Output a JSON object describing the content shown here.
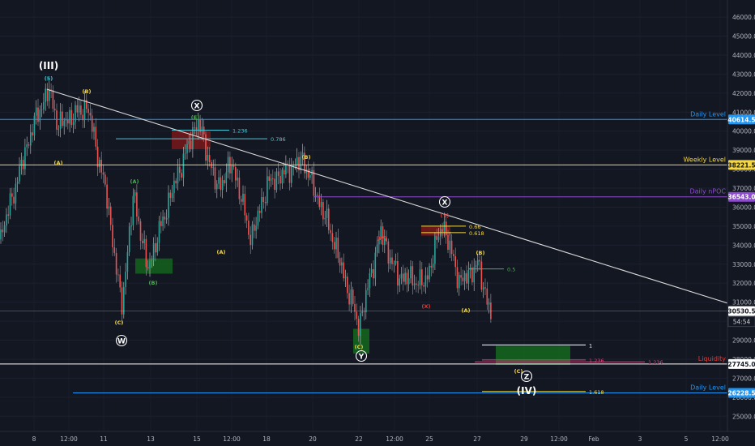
{
  "chart_data": {
    "type": "candlestick",
    "ylim": [
      24200,
      46900
    ],
    "y_ticks": [
      25000,
      26000,
      27000,
      28000,
      29000,
      30000,
      31000,
      32000,
      33000,
      34000,
      35000,
      36000,
      37000,
      38000,
      39000,
      40000,
      41000,
      42000,
      43000,
      44000,
      45000,
      46000
    ],
    "y_tick_labels": [
      "25000.0",
      "26000.0",
      "27000.0",
      "28000.0",
      "29000.0",
      "30000.0",
      "31000.0",
      "32000.0",
      "33000.0",
      "34000.0",
      "35000.0",
      "36000.0",
      "37000.0",
      "38000.0",
      "39000.0",
      "40000.0",
      "41000.0",
      "42000.0",
      "43000.0",
      "44000.0",
      "45000.0",
      "46000.0"
    ],
    "x_ticks": [
      "8",
      "12:00",
      "11",
      "13",
      "15",
      "12:00",
      "18",
      "20",
      "22",
      "12:00",
      "25",
      "27",
      "29",
      "12:00",
      "Feb",
      "3",
      "5",
      "12:00"
    ],
    "price_markers": [
      {
        "label": "Daily Level",
        "price": 40614.5,
        "price_text": "40614.5",
        "color": "#2196f3"
      },
      {
        "label": "Weekly Level",
        "price": 38221.5,
        "price_text": "38221.5",
        "color": "#f5d742"
      },
      {
        "label": "Daily nPOC",
        "price": 36543.0,
        "price_text": "36543.0",
        "color": "#8e4bd0"
      },
      {
        "label": "",
        "price": 30530.5,
        "price_text": "30530.5",
        "color": "#ffffff"
      },
      {
        "label": "Liquidity",
        "price": 27745.0,
        "price_text": "27745.0",
        "color": "#ffffff"
      },
      {
        "label": "Daily Level",
        "price": 26228.5,
        "price_text": "26228.5",
        "color": "#2196f3"
      }
    ],
    "countdown": "54:54",
    "fib_levels": [
      {
        "text": "1.236",
        "color": "#4ac7d6"
      },
      {
        "text": "0.786",
        "color": "#4ac7d6"
      },
      {
        "text": "0.66",
        "color": "#f5d742"
      },
      {
        "text": "0.618",
        "color": "#f5d742"
      },
      {
        "text": "0.5",
        "color": "#4caf50"
      },
      {
        "text": "1",
        "color": "#ffffff"
      },
      {
        "text": "1.236",
        "color": "#e0407a"
      },
      {
        "text": "1.236",
        "color": "#c05080"
      },
      {
        "text": "1.618",
        "color": "#f5d742"
      }
    ],
    "wave_labels": [
      {
        "text": "(III)",
        "color": "#ffffff",
        "circled": false,
        "big": true
      },
      {
        "text": "(5)",
        "color": "#4ac7d6",
        "circled": false
      },
      {
        "text": "(B)",
        "color": "#f5d742",
        "circled": false
      },
      {
        "text": "(A)",
        "color": "#f5d742",
        "circled": false
      },
      {
        "text": "X",
        "color": "#ffffff",
        "circled": true
      },
      {
        "text": "(E)",
        "color": "#4caf50",
        "circled": false
      },
      {
        "text": "(A)",
        "color": "#4caf50",
        "circled": false
      },
      {
        "text": "(B)",
        "color": "#4caf50",
        "circled": false
      },
      {
        "text": "(C)",
        "color": "#f5d742",
        "circled": false
      },
      {
        "text": "W",
        "color": "#ffffff",
        "circled": true
      },
      {
        "text": "(A)",
        "color": "#f5d742",
        "circled": false
      },
      {
        "text": "(B)",
        "color": "#f5d742",
        "circled": false
      },
      {
        "text": "(W)",
        "color": "#e53935",
        "circled": false
      },
      {
        "text": "(C)",
        "color": "#f5d742",
        "circled": false
      },
      {
        "text": "Y",
        "color": "#ffffff",
        "circled": true
      },
      {
        "text": "(X)",
        "color": "#e53935",
        "circled": false
      },
      {
        "text": "X",
        "color": "#ffffff",
        "circled": true
      },
      {
        "text": "(Y)",
        "color": "#e53935",
        "circled": false
      },
      {
        "text": "(B)",
        "color": "#f5d742",
        "circled": false
      },
      {
        "text": "(A)",
        "color": "#f5d742",
        "circled": false
      },
      {
        "text": "(C)",
        "color": "#f5d742",
        "circled": false
      },
      {
        "text": "Z",
        "color": "#ffffff",
        "circled": true
      },
      {
        "text": "(IV)",
        "color": "#ffffff",
        "circled": false,
        "big": true
      }
    ],
    "trendline": {
      "from": 42200,
      "to": 30950
    }
  }
}
